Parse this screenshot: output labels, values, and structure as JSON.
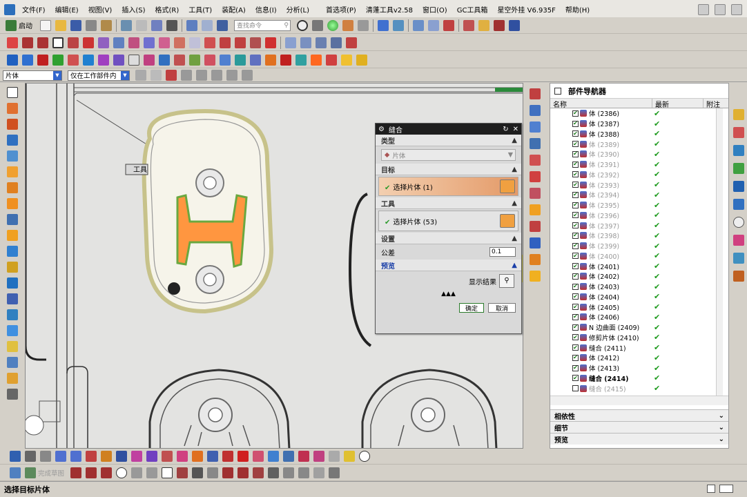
{
  "menubar": {
    "items": [
      "文件(F)",
      "编辑(E)",
      "视图(V)",
      "插入(S)",
      "格式(R)",
      "工具(T)",
      "装配(A)",
      "信息(I)",
      "分析(L)",
      "首选项(P)",
      "清蓬工具v2.58",
      "窗口(O)",
      "GC工具箱",
      "星空外挂 V6.935F",
      "帮助(H)"
    ]
  },
  "toolbar": {
    "start_label": "启动",
    "search_placeholder": "查找命令"
  },
  "filter": {
    "type_value": "片体",
    "scope_value": "仅在工作部件内"
  },
  "canvas": {
    "tooltip_label": "工具"
  },
  "dialog": {
    "title": "缝合",
    "type_section": "类型",
    "type_value": "片体",
    "target_section": "目标",
    "target_select": "选择片体 (1)",
    "tool_section": "工具",
    "tool_select": "选择片体 (53)",
    "settings_section": "设置",
    "tolerance_label": "公差",
    "tolerance_value": "0.1",
    "preview_section": "预览",
    "show_result_label": "显示结果",
    "ok_label": "确定",
    "cancel_label": "取消"
  },
  "navigator": {
    "title": "部件导航器",
    "columns": [
      "名称",
      "最新",
      "附注"
    ],
    "rows": [
      {
        "label": "体 (2386)",
        "dim": false
      },
      {
        "label": "体 (2387)",
        "dim": false
      },
      {
        "label": "体 (2388)",
        "dim": false
      },
      {
        "label": "体 (2389)",
        "dim": true
      },
      {
        "label": "体 (2390)",
        "dim": true
      },
      {
        "label": "体 (2391)",
        "dim": true
      },
      {
        "label": "体 (2392)",
        "dim": true
      },
      {
        "label": "体 (2393)",
        "dim": true
      },
      {
        "label": "体 (2394)",
        "dim": true
      },
      {
        "label": "体 (2395)",
        "dim": true
      },
      {
        "label": "体 (2396)",
        "dim": true
      },
      {
        "label": "体 (2397)",
        "dim": true
      },
      {
        "label": "体 (2398)",
        "dim": true
      },
      {
        "label": "体 (2399)",
        "dim": true
      },
      {
        "label": "体 (2400)",
        "dim": true
      },
      {
        "label": "体 (2401)",
        "dim": false
      },
      {
        "label": "体 (2402)",
        "dim": false
      },
      {
        "label": "体 (2403)",
        "dim": false
      },
      {
        "label": "体 (2404)",
        "dim": false
      },
      {
        "label": "体 (2405)",
        "dim": false
      },
      {
        "label": "体 (2406)",
        "dim": false
      },
      {
        "label": "N 边曲面 (2409)",
        "dim": false
      },
      {
        "label": "修剪片体 (2410)",
        "dim": false
      },
      {
        "label": "缝合 (2411)",
        "dim": false
      },
      {
        "label": "体 (2412)",
        "dim": false
      },
      {
        "label": "体 (2413)",
        "dim": false
      },
      {
        "label": "缝合 (2414)",
        "dim": false,
        "bold": true
      },
      {
        "label": "缝合 (2415)",
        "dim": true
      }
    ],
    "panels": [
      "相依性",
      "细节",
      "预览"
    ]
  },
  "bottom": {
    "sketch_label": "完成草图"
  },
  "status": {
    "text": "选择目标片体"
  }
}
